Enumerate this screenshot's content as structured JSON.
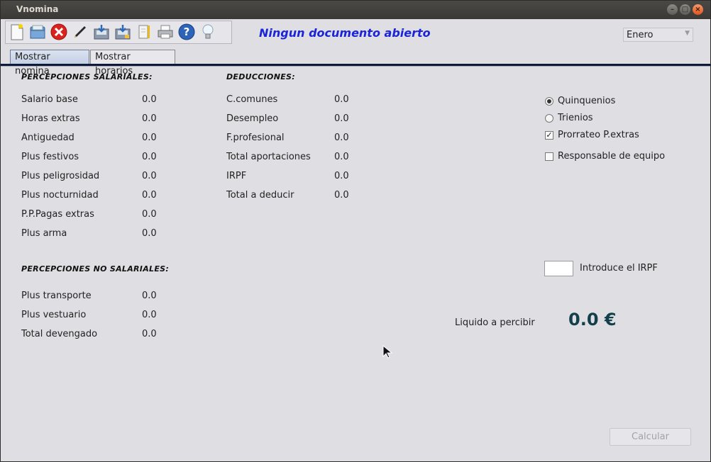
{
  "window": {
    "title": "Vnomina"
  },
  "toolbar": {
    "icons": [
      "new-document-icon",
      "open-folder-icon",
      "close-red-icon",
      "pencil-icon",
      "save-disk-icon",
      "save-as-disk-icon",
      "notebook-icon",
      "printer-icon",
      "help-icon",
      "lightbulb-icon"
    ]
  },
  "heading": "Ningun documento abierto",
  "month_select": {
    "value": "Enero"
  },
  "tabs": [
    {
      "label": "Mostrar nomina"
    },
    {
      "label": "Mostrar horarios"
    }
  ],
  "percepciones_salariales": {
    "title": "PERCEPCIONES SALARIALES:",
    "rows": [
      {
        "label": "Salario base",
        "value": "0.0"
      },
      {
        "label": "Horas extras",
        "value": "0.0"
      },
      {
        "label": "Antiguedad",
        "value": "0.0"
      },
      {
        "label": "Plus festivos",
        "value": "0.0"
      },
      {
        "label": "Plus peligrosidad",
        "value": "0.0"
      },
      {
        "label": "Plus nocturnidad",
        "value": "0.0"
      },
      {
        "label": "P.P.Pagas extras",
        "value": "0.0"
      },
      {
        "label": "Plus arma",
        "value": "0.0"
      }
    ]
  },
  "deducciones": {
    "title": "DEDUCCIONES:",
    "rows": [
      {
        "label": "C.comunes",
        "value": "0.0"
      },
      {
        "label": "Desempleo",
        "value": "0.0"
      },
      {
        "label": "F.profesional",
        "value": "0.0"
      },
      {
        "label": "Total aportaciones",
        "value": "0.0"
      },
      {
        "label": "IRPF",
        "value": "0.0"
      },
      {
        "label": "Total a deducir",
        "value": "0.0"
      }
    ]
  },
  "percepciones_no_salariales": {
    "title": "PERCEPCIONES NO SALARIALES:",
    "rows": [
      {
        "label": "Plus transporte",
        "value": "0.0"
      },
      {
        "label": "Plus vestuario",
        "value": "0.0"
      },
      {
        "label": "Total devengado",
        "value": "0.0"
      }
    ]
  },
  "options": {
    "quinquenios": "Quinquenios",
    "trienios": "Trienios",
    "prorrateo": "Prorrateo P.extras",
    "responsable": "Responsable de equipo"
  },
  "irpf": {
    "label": "Introduce el IRPF",
    "value": ""
  },
  "liquido": {
    "label": "Liquido a percibir",
    "value": "0.0 €"
  },
  "calcular": {
    "label": "Calcular"
  },
  "colors": {
    "heading": "#1a24d8",
    "liquido": "#123f4a",
    "tab_underline": "#0d1a3a"
  }
}
